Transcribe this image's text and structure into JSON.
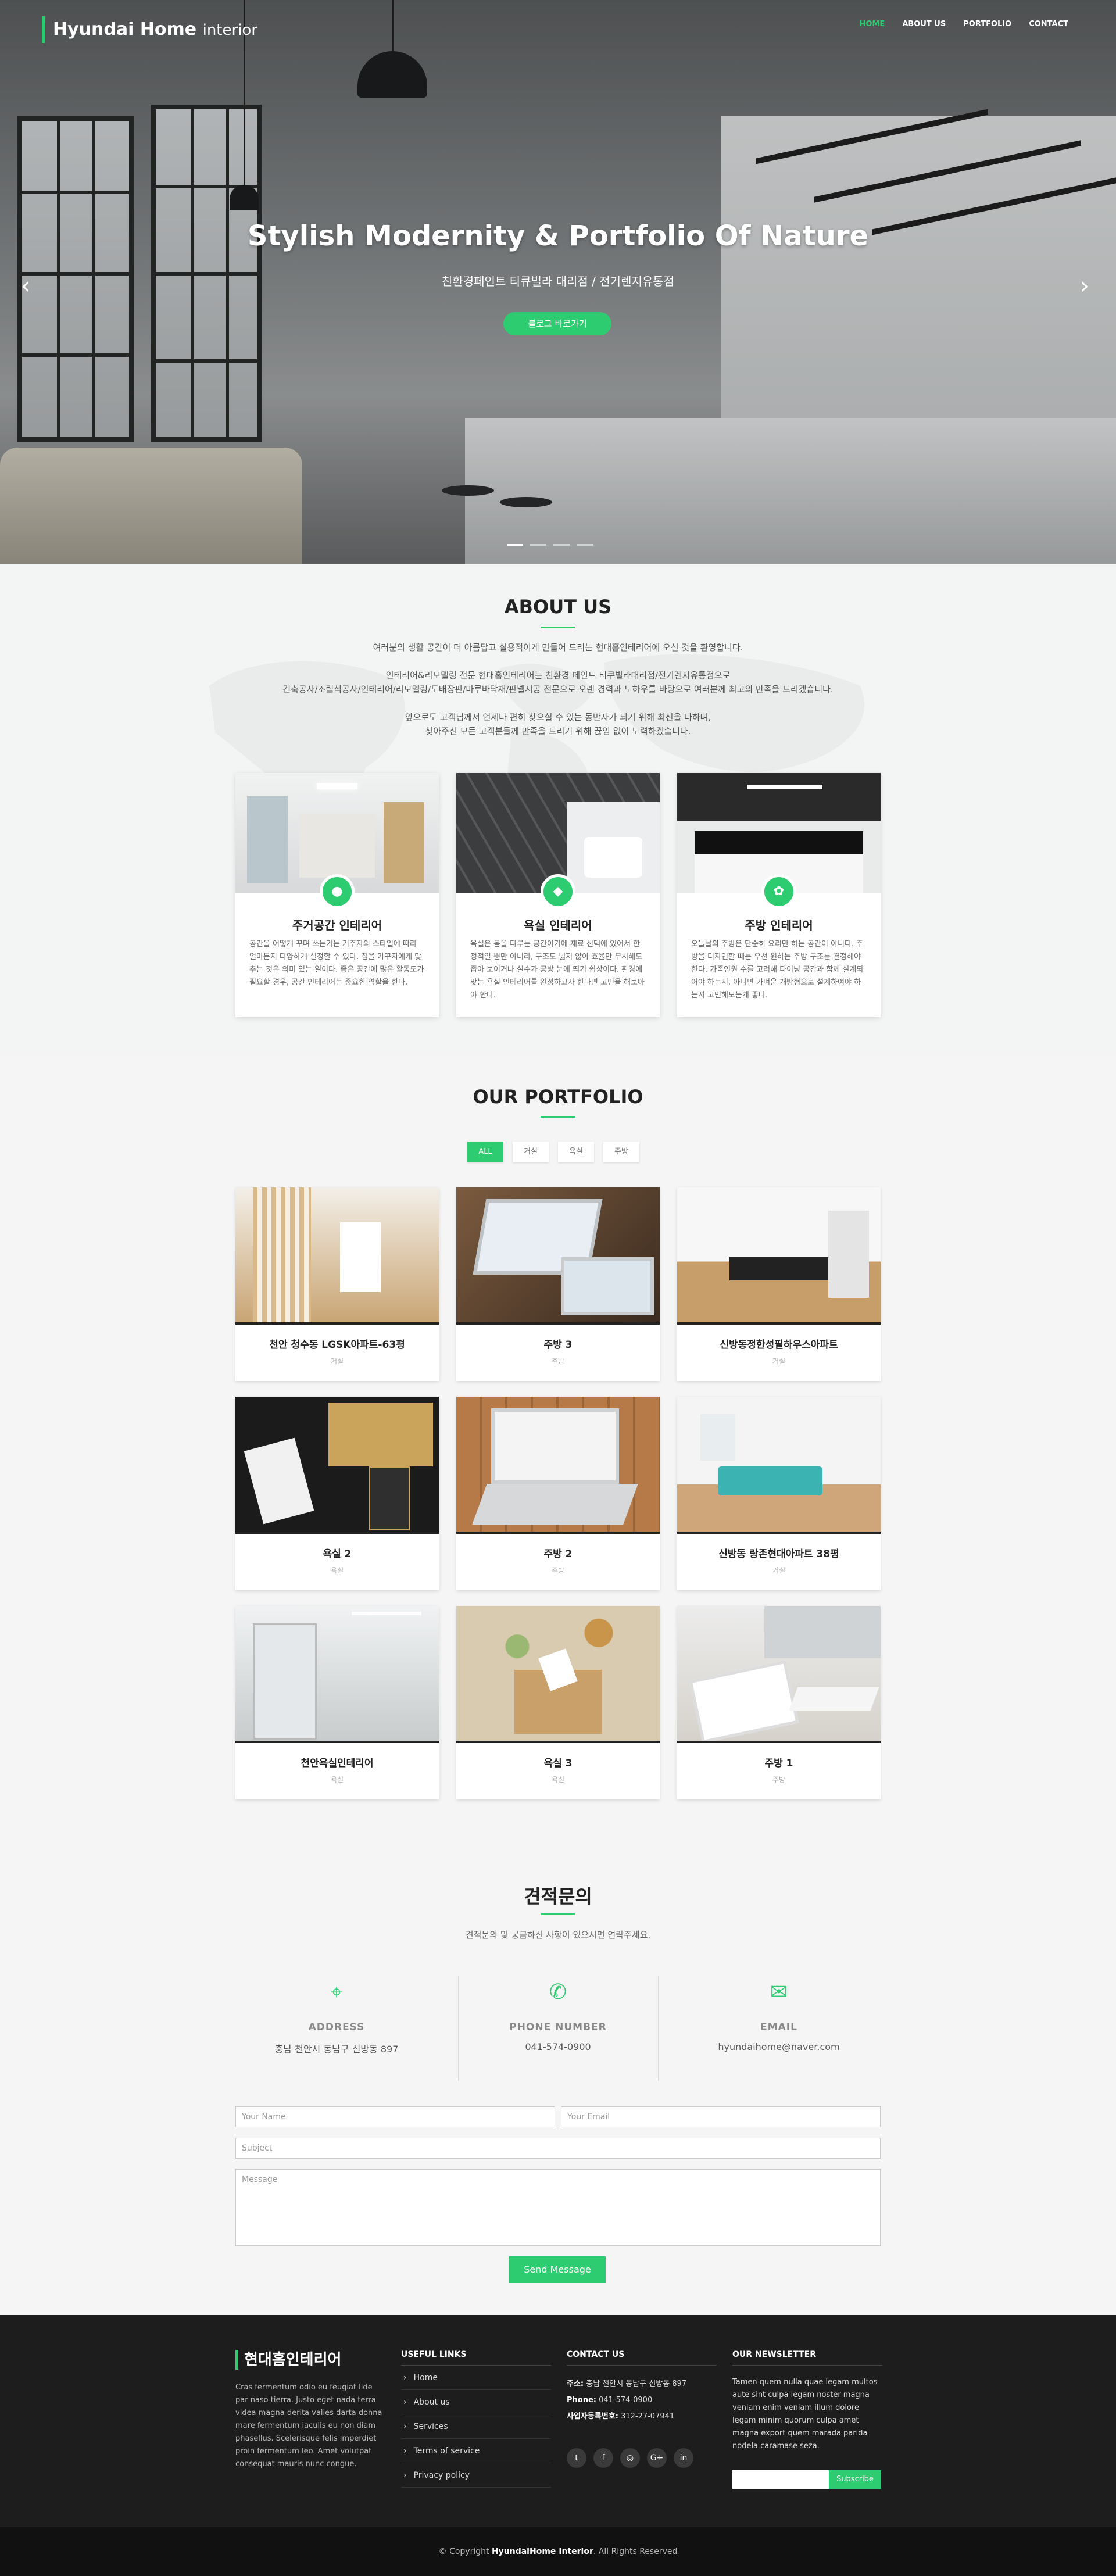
{
  "header": {
    "logo_main": "Hyundai Home",
    "logo_sub": "interior",
    "nav": [
      "HOME",
      "ABOUT US",
      "PORTFOLIO",
      "CONTACT"
    ]
  },
  "hero": {
    "title": "Stylish Modernity & Portfolio Of Nature",
    "subtitle": "친환경페인트 티큐빌라 대리점 / 전기렌지유통점",
    "button": "블로그 바로가기",
    "prev": "‹",
    "next": "›"
  },
  "about": {
    "title": "ABOUT US",
    "p1": "여러분의 생활 공간이 더 아름답고 실용적이게 만들어 드리는 현대홈인테리어에 오신 것을 환영합니다.",
    "p2a": "인테리어&리모델링 전문 현대홈인테리어는 친환경 페인트 티쿠빌라대리점/전기렌지유통점으로",
    "p2b": "건축공사/조립식공사/인테리어/리모델링/도배장판/마루바닥재/판넬시공 전문으로 오랜 경력과 노하우를 바탕으로 여러분께 최고의 만족을 드리겠습니다.",
    "p3a": "앞으로도 고객님께서 언제나 편히 찾으실 수 있는 동반자가 되기 위해 최선을 다하며,",
    "p3b": "찾아주신 모든 고객분들께 만족을 드리기 위해 끊임 없이 노력하겠습니다.",
    "cards": [
      {
        "title": "주거공간 인테리어",
        "text": "공간을 어떻게 꾸며 쓰는가는 거주자의 스타일에 따라 얼마든지 다양하게 설정할 수 있다. 집을 가꾸자에게 맞추는 것은 의미 있는 일이다. 좋은 공간에 많은 활동도가 필요할 경우, 공간 인테리어는 중요한 역할을 한다."
      },
      {
        "title": "욕실 인테리어",
        "text": "욕실은 몸을 다루는 공간이기에 재료 선택에 있어서 한정적일 뿐만 아니라, 구조도 넓지 않아 효율만 무시해도 좁아 보이거나 실수가 공방 눈에 띄기 쉽상이다. 환경에 맞는 욕실 인테리어를 완성하고자 한다면 고민을 해보아야 한다."
      },
      {
        "title": "주방 인테리어",
        "text": "오늘날의 주방은 단순히 요리만 하는 공간이 아니다. 주방을 디자인할 때는 우선 원하는 주방 구조를 결정해야 한다. 가족인원 수를 고려해 다이닝 공간과 함께 설계되어야 하는지, 아니면 가벼운 개방형으로 설계하여야 하는지 고민해보는게 좋다."
      }
    ]
  },
  "portfolio": {
    "title": "OUR PORTFOLIO",
    "filters": [
      "ALL",
      "거실",
      "욕실",
      "주방"
    ],
    "items": [
      {
        "title": "천안 청수동 LGSK아파트-63평",
        "cat": "거실"
      },
      {
        "title": "주방 3",
        "cat": "주방"
      },
      {
        "title": "신방동정한성필하우스아파트",
        "cat": "거실"
      },
      {
        "title": "욕실 2",
        "cat": "욕실"
      },
      {
        "title": "주방 2",
        "cat": "주방"
      },
      {
        "title": "신방동 랑존현대아파트 38평",
        "cat": "거실"
      },
      {
        "title": "천안욕실인테리어",
        "cat": "욕실"
      },
      {
        "title": "욕실 3",
        "cat": "욕실"
      },
      {
        "title": "주방 1",
        "cat": "주방"
      }
    ]
  },
  "contact": {
    "title": "견적문의",
    "subtitle": "견적문의 및 궁금하신 사항이 있으시면 연락주세요.",
    "address_label": "ADDRESS",
    "address": "충남 천안시 동남구 신방동 897",
    "phone_label": "PHONE NUMBER",
    "phone": "041-574-0900",
    "email_label": "EMAIL",
    "email": "hyundaihome@naver.com",
    "ph_name": "Your Name",
    "ph_email": "Your Email",
    "ph_subject": "Subject",
    "ph_message": "Message",
    "send": "Send Message"
  },
  "footer": {
    "brand": "현대홈인테리어",
    "about_text": "Cras fermentum odio eu feugiat lide par naso tierra. Justo eget nada terra videa magna derita valies darta donna mare fermentum iaculis eu non diam phasellus. Scelerisque felis imperdiet proin fermentum leo. Amet volutpat consequat mauris nunc congue.",
    "links_title": "USEFUL LINKS",
    "links": [
      "Home",
      "About us",
      "Services",
      "Terms of service",
      "Privacy policy"
    ],
    "contact_title": "CONTACT US",
    "addr_label": "주소:",
    "addr": "충남 천안시 동남구 신방동 897",
    "phone_label": "Phone:",
    "phone": "041-574-0900",
    "biz_label": "사업자등록번호:",
    "biz": "312-27-07941",
    "socials": [
      "t",
      "f",
      "◎",
      "G+",
      "in"
    ],
    "news_title": "OUR NEWSLETTER",
    "news_text": "Tamen quem nulla quae legam multos aute sint culpa legam noster magna veniam enim veniam illum dolore legam minim quorum culpa amet magna export quem marada parida nodela caramase seza.",
    "subscribe": "Subscribe"
  },
  "copyright": {
    "prefix": "© Copyright ",
    "brand": "HyundaiHome Interior",
    "suffix": ". All Rights Reserved"
  },
  "colors": {
    "accent": "#2ecc71",
    "footer": "#1d1d1d",
    "bottom": "#111111"
  }
}
